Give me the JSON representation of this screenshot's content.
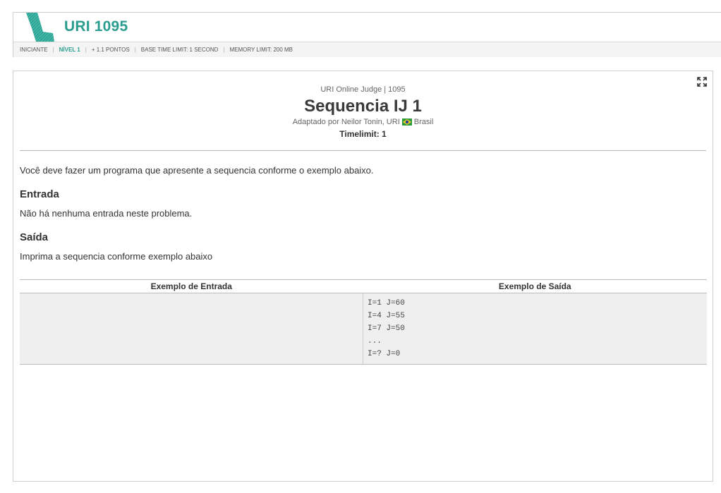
{
  "header": {
    "problem_heading": "URI 1095",
    "logo_icon": "uri-logo-icon",
    "meta": {
      "category": "INICIANTE",
      "level": "NÍVEL 1",
      "points": "+ 1.1 PONTOS",
      "base_time_limit": "BASE TIME LIMIT: 1 SECOND",
      "memory_limit": "MEMORY LIMIT: 200 MB"
    },
    "accent_color": "#2a9d8f"
  },
  "problem": {
    "judge_line": "URI Online Judge | 1095",
    "title": "Sequencia IJ 1",
    "author_prefix": "Adaptado por Neilor Tonin, URI",
    "country": "Brasil",
    "timelimit": "Timelimit: 1",
    "description": "Você deve fazer um programa que apresente a sequencia conforme o exemplo abaixo.",
    "input_title": "Entrada",
    "input_text": "Não há nenhuma entrada neste problema.",
    "output_title": "Saída",
    "output_text": "Imprima a sequencia conforme exemplo abaixo"
  },
  "examples": {
    "input_header": "Exemplo de Entrada",
    "output_header": "Exemplo de Saída",
    "input_lines": [],
    "output_lines": [
      "I=1 J=60",
      "I=4 J=55",
      "I=7 J=50",
      "...",
      "I=? J=0"
    ]
  },
  "icons": {
    "expand": "expand-icon",
    "flag": "brazil-flag-icon"
  }
}
